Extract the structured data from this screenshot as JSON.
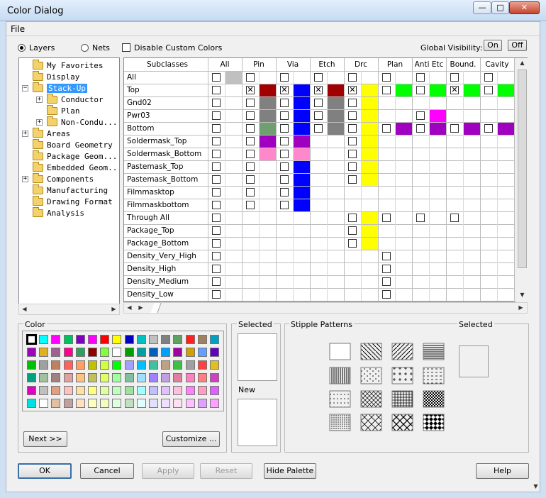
{
  "window": {
    "title": "Color Dialog",
    "min": "—",
    "max": "□",
    "close": "✕"
  },
  "menu": {
    "file": "File"
  },
  "options": {
    "layers": "Layers",
    "nets": "Nets",
    "disable_custom": "Disable Custom Colors",
    "global_visibility": "Global Visibility:",
    "on": "On",
    "off": "Off"
  },
  "tree": [
    {
      "label": "My Favorites",
      "level": 0,
      "expander": ""
    },
    {
      "label": "Display",
      "level": 0,
      "expander": ""
    },
    {
      "label": "Stack-Up",
      "level": 0,
      "expander": "−",
      "selected": true
    },
    {
      "label": "Conductor",
      "level": 1,
      "expander": "+"
    },
    {
      "label": "Plan",
      "level": 1,
      "expander": ""
    },
    {
      "label": "Non-Condu...",
      "level": 1,
      "expander": "+"
    },
    {
      "label": "Areas",
      "level": 0,
      "expander": "+"
    },
    {
      "label": "Board Geometry",
      "level": 0,
      "expander": ""
    },
    {
      "label": "Package Geom...",
      "level": 0,
      "expander": ""
    },
    {
      "label": "Embedded Geom...",
      "level": 0,
      "expander": ""
    },
    {
      "label": "Components",
      "level": 0,
      "expander": "+"
    },
    {
      "label": "Manufacturing",
      "level": 0,
      "expander": ""
    },
    {
      "label": "Drawing Format",
      "level": 0,
      "expander": ""
    },
    {
      "label": "Analysis",
      "level": 0,
      "expander": ""
    }
  ],
  "grid": {
    "subclass_header": "Subclasses",
    "columns": [
      "All",
      "Pin",
      "Via",
      "Etch",
      "Drc",
      "Plan",
      "Anti Etc",
      "Bound.",
      "Cavity"
    ],
    "rows": [
      {
        "name": "All",
        "cells": [
          "a",
          "c",
          "c",
          "c",
          "c",
          "c",
          "c",
          "c",
          "c"
        ],
        "colors": [
          "#c0c0c0",
          "",
          "",
          "",
          "",
          "",
          "",
          "",
          ""
        ]
      },
      {
        "name": "Top",
        "cells": [
          "c",
          "x",
          "x",
          "x",
          "x",
          "c",
          "c",
          "x",
          "c"
        ],
        "colors": [
          "",
          "#a00000",
          "#0000ff",
          "#a00000",
          "#ffff00",
          "#00ff00",
          "#00ff00",
          "#00ff00",
          "#00ff00"
        ]
      },
      {
        "name": "Gnd02",
        "cells": [
          "c",
          "c",
          "c",
          "c",
          "c",
          "",
          "",
          "",
          ""
        ],
        "colors": [
          "",
          "#808080",
          "#0000ff",
          "#808080",
          "#ffff00",
          "",
          "",
          "",
          ""
        ]
      },
      {
        "name": "Pwr03",
        "cells": [
          "c",
          "c",
          "c",
          "c",
          "c",
          "",
          "c",
          "",
          ""
        ],
        "colors": [
          "",
          "#808080",
          "#0000ff",
          "#808080",
          "#ffff00",
          "",
          "#ff00ff",
          "",
          ""
        ]
      },
      {
        "name": "Bottom",
        "cells": [
          "c",
          "c",
          "c",
          "c",
          "c",
          "c",
          "c",
          "c",
          "c"
        ],
        "colors": [
          "",
          "#6f9f6f",
          "#0000ff",
          "#808080",
          "#ffff00",
          "#a000c0",
          "#a000c0",
          "#a000c0",
          "#a000c0"
        ]
      },
      {
        "name": "Soldermask_Top",
        "cells": [
          "c",
          "c",
          "c",
          "",
          "c",
          "",
          "",
          "",
          ""
        ],
        "colors": [
          "",
          "#a000c0",
          "#a000c0",
          "",
          "#ffff00",
          "",
          "",
          "",
          ""
        ]
      },
      {
        "name": "Soldermask_Bottom",
        "cells": [
          "c",
          "c",
          "c",
          "",
          "c",
          "",
          "",
          "",
          ""
        ],
        "colors": [
          "",
          "#ff88cc",
          "#ff88cc",
          "",
          "#ffff00",
          "",
          "",
          "",
          ""
        ]
      },
      {
        "name": "Pastemask_Top",
        "cells": [
          "c",
          "c",
          "c",
          "",
          "c",
          "",
          "",
          "",
          ""
        ],
        "colors": [
          "",
          "",
          "#0000ff",
          "",
          "#ffff00",
          "",
          "",
          "",
          ""
        ]
      },
      {
        "name": "Pastemask_Bottom",
        "cells": [
          "c",
          "c",
          "c",
          "",
          "c",
          "",
          "",
          "",
          ""
        ],
        "colors": [
          "",
          "",
          "#0000ff",
          "",
          "#ffff00",
          "",
          "",
          "",
          ""
        ]
      },
      {
        "name": "Filmmasktop",
        "cells": [
          "c",
          "c",
          "c",
          "",
          "",
          "",
          "",
          "",
          ""
        ],
        "colors": [
          "",
          "",
          "#0000ff",
          "",
          "",
          "",
          "",
          "",
          ""
        ]
      },
      {
        "name": "Filmmaskbottom",
        "cells": [
          "c",
          "c",
          "c",
          "",
          "",
          "",
          "",
          "",
          ""
        ],
        "colors": [
          "",
          "",
          "#0000ff",
          "",
          "",
          "",
          "",
          "",
          ""
        ]
      },
      {
        "name": "Through All",
        "cells": [
          "c",
          "",
          "",
          "",
          "c",
          "c",
          "c",
          "c",
          ""
        ],
        "colors": [
          "",
          "",
          "",
          "",
          "#ffff00",
          "",
          "",
          "",
          ""
        ]
      },
      {
        "name": "Package_Top",
        "cells": [
          "c",
          "",
          "",
          "",
          "c",
          "",
          "",
          "",
          ""
        ],
        "colors": [
          "",
          "",
          "",
          "",
          "#ffff00",
          "",
          "",
          "",
          ""
        ]
      },
      {
        "name": "Package_Bottom",
        "cells": [
          "c",
          "",
          "",
          "",
          "c",
          "",
          "",
          "",
          ""
        ],
        "colors": [
          "",
          "",
          "",
          "",
          "#ffff00",
          "",
          "",
          "",
          ""
        ]
      },
      {
        "name": "Density_Very_High",
        "cells": [
          "c",
          "",
          "",
          "",
          "",
          "c",
          "",
          "",
          ""
        ],
        "colors": [
          "",
          "",
          "",
          "",
          "",
          "",
          "",
          "",
          ""
        ]
      },
      {
        "name": "Density_High",
        "cells": [
          "c",
          "",
          "",
          "",
          "",
          "c",
          "",
          "",
          ""
        ],
        "colors": [
          "",
          "",
          "",
          "",
          "",
          "",
          "",
          "",
          ""
        ]
      },
      {
        "name": "Density_Medium",
        "cells": [
          "c",
          "",
          "",
          "",
          "",
          "c",
          "",
          "",
          ""
        ],
        "colors": [
          "",
          "",
          "",
          "",
          "",
          "",
          "",
          "",
          ""
        ]
      },
      {
        "name": "Density_Low",
        "cells": [
          "c",
          "",
          "",
          "",
          "",
          "c",
          "",
          "",
          ""
        ],
        "colors": [
          "",
          "",
          "",
          "",
          "",
          "",
          "",
          "",
          ""
        ]
      }
    ]
  },
  "color_panel": {
    "label": "Color",
    "next": "Next >>",
    "customize": "Customize ...",
    "palette": [
      [
        "#ffffff",
        "#00ffff",
        "#ff00ff",
        "#00c060",
        "#8000c0",
        "#ff00ff",
        "#ff0000",
        "#ffff00",
        "#0000c0",
        "#00c0c0",
        "#c0c0c0",
        "#808080",
        "#60a060",
        "#ff2020",
        "#a08060",
        "#00a0c0"
      ],
      [
        "#a000c0",
        "#e0b020",
        "#a06090",
        "#ff0090",
        "#30a060",
        "#900000",
        "#80ff40",
        "#ffffff",
        "#00a000",
        "#00a0a0",
        "#0060c0",
        "#00a0ff",
        "#a000a0",
        "#d0a000",
        "#60a0ff",
        "#6000c0"
      ],
      [
        "#00c000",
        "#a0a0a0",
        "#c08060",
        "#ff6060",
        "#ffa060",
        "#c0c000",
        "#d0ff40",
        "#00ff00",
        "#a0a0ff",
        "#00c0ff",
        "#40c0a0",
        "#c0a080",
        "#40c040",
        "#a0a0a0",
        "#ff4040",
        "#e0c020"
      ],
      [
        "#00a080",
        "#a0c0a0",
        "#a08080",
        "#e0a0a0",
        "#ffc080",
        "#c0c060",
        "#e0ff60",
        "#a0ffa0",
        "#80c0a0",
        "#a0e0ff",
        "#a080ff",
        "#c0a0e0",
        "#e080a0",
        "#ff80c0",
        "#ff8080",
        "#d040c0"
      ],
      [
        "#e000c0",
        "#c0c0c0",
        "#e0a080",
        "#ffc0c0",
        "#ffe0a0",
        "#ffff80",
        "#e0ffa0",
        "#c0ffc0",
        "#a0e0a0",
        "#a0ffff",
        "#c0c0ff",
        "#e0c0ff",
        "#ffc0e0",
        "#ff80ff",
        "#ffa0c0",
        "#e060ff"
      ],
      [
        "#00e0e0",
        "#ffffff",
        "#e0c0a0",
        "#c0a0a0",
        "#ffe0c0",
        "#ffffc0",
        "#f0ffc0",
        "#e0ffe0",
        "#c0e0c0",
        "#e0ffff",
        "#e0e0ff",
        "#f0e0ff",
        "#ffe0f0",
        "#ffc0ff",
        "#e0a0ff",
        "#ffa0ff"
      ]
    ]
  },
  "selected_label": "Selected",
  "new_label": "New",
  "stipple": {
    "label": "Stipple Patterns",
    "selected": "Selected"
  },
  "buttons": {
    "ok": "OK",
    "cancel": "Cancel",
    "apply": "Apply",
    "reset": "Reset",
    "hide_palette": "Hide Palette",
    "help": "Help"
  }
}
